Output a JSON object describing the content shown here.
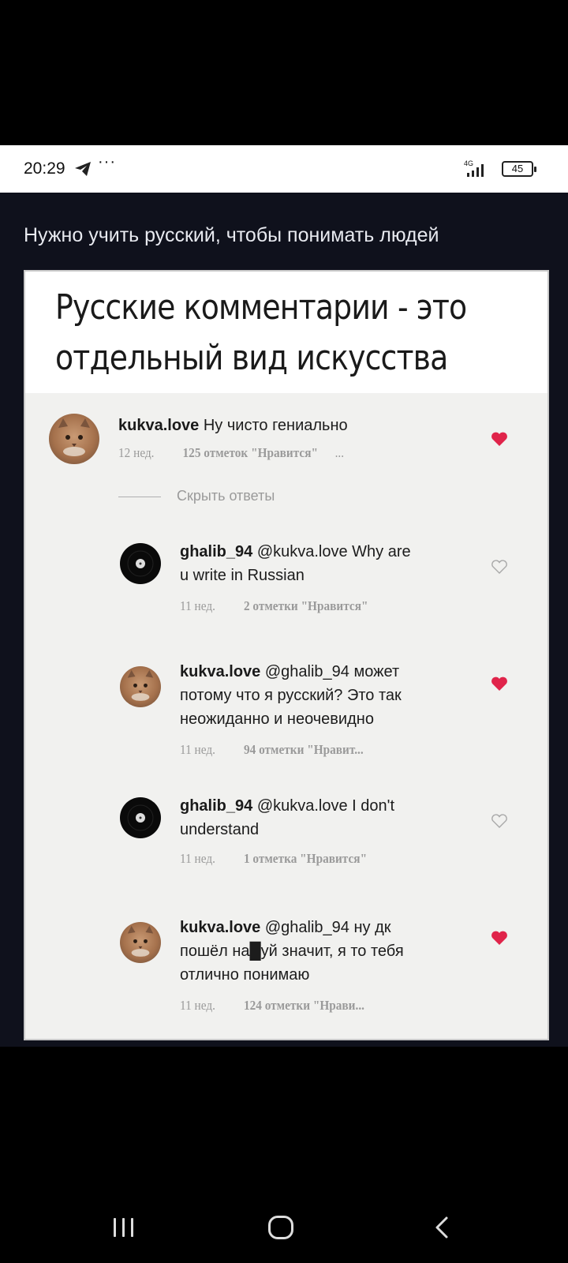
{
  "status_bar": {
    "time": "20:29",
    "telegram_icon": "telegram-plane-icon",
    "overflow_dots": "···",
    "network": "4G",
    "battery": "45"
  },
  "post": {
    "caption": "Нужно учить русский, чтобы понимать людей"
  },
  "meme": {
    "title_line1": "Русские комментарии - это",
    "title_line2": "отдельный вид искусства",
    "hide_replies": "Скрыть ответы",
    "comments": [
      {
        "user": "kukva.love",
        "lines": [
          "Ну чисто гениально"
        ],
        "age": "12 нед.",
        "likes": "125 отметок \"Нравится\"",
        "more": "...",
        "liked": true
      },
      {
        "user": "ghalib_94",
        "lines": [
          "@kukva.love Why are",
          "u write in Russian"
        ],
        "age": "11 нед.",
        "likes": "2 отметки \"Нравится\"",
        "liked": false
      },
      {
        "user": "kukva.love",
        "lines": [
          "@ghalib_94 может",
          "потому что я русский? Это так",
          "неожиданно и неочевидно"
        ],
        "age": "11 нед.",
        "likes": "94 отметки \"Нравит...",
        "liked": true
      },
      {
        "user": "ghalib_94",
        "lines": [
          "@kukva.love I don't",
          "understand"
        ],
        "age": "11 нед.",
        "likes": "1 отметка \"Нравится\"",
        "liked": false
      },
      {
        "user": "kukva.love",
        "lines": [
          "@ghalib_94 ну дк",
          "пошёл на█уй значит, я то тебя",
          "отлично понимаю"
        ],
        "age": "11 нед.",
        "likes": "124 отметки \"Нрави...",
        "liked": true
      }
    ]
  },
  "nav": {
    "recents_icon": "recent-apps-icon",
    "home_icon": "home-icon",
    "back_icon": "back-icon"
  },
  "colors": {
    "heart_liked": "#e0244a",
    "heart_outline": "#a8a8a8",
    "post_background": "#0f111c"
  }
}
